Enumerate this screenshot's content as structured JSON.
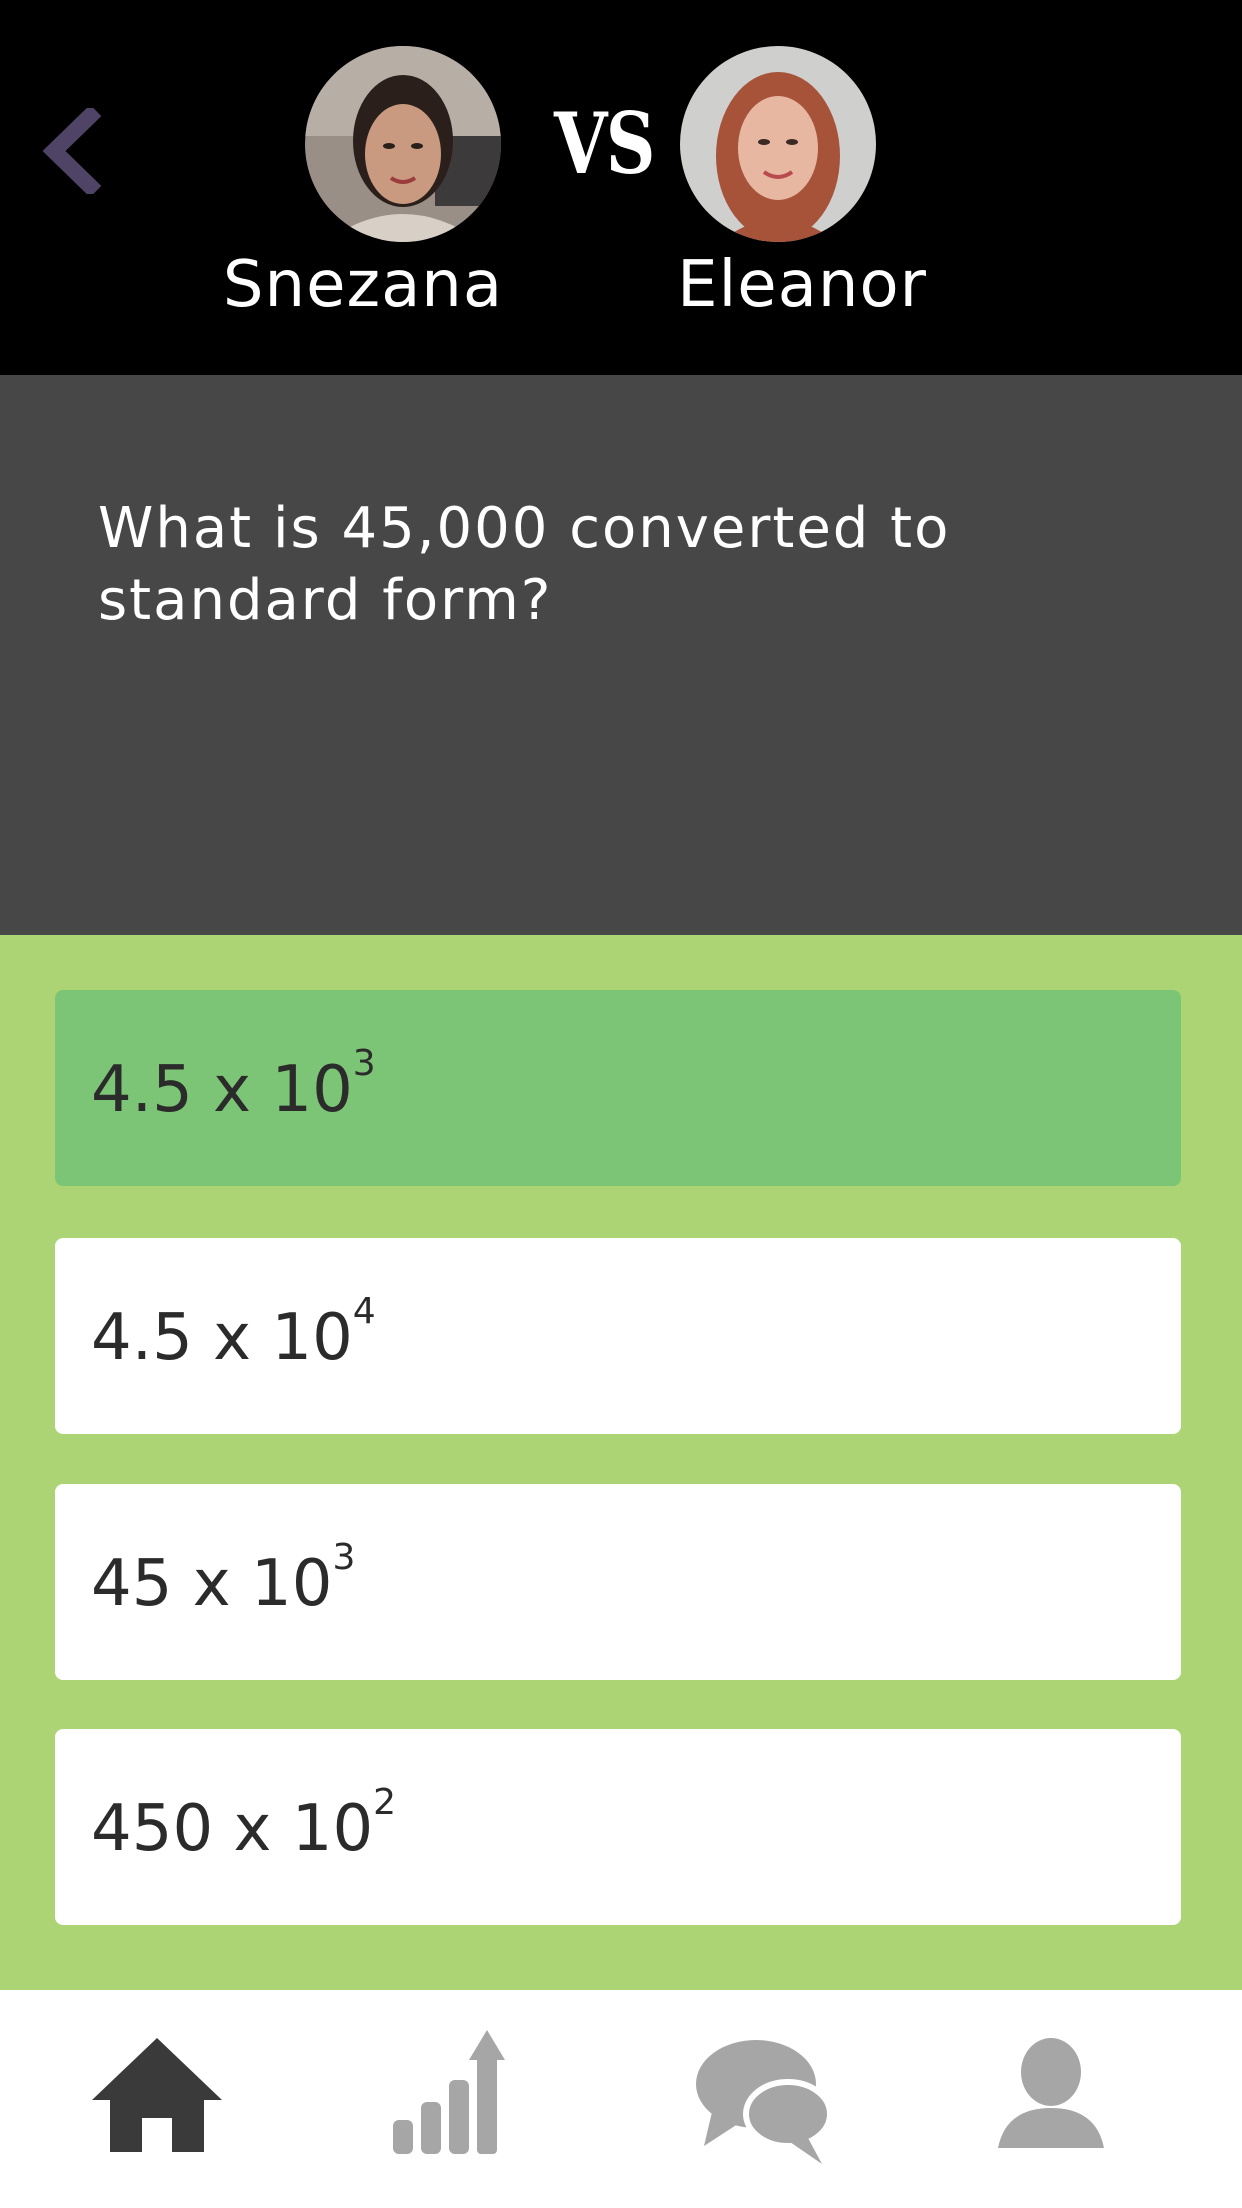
{
  "header": {
    "vs_label": "VS",
    "player1": {
      "name": "Snezana"
    },
    "player2": {
      "name": "Eleanor"
    }
  },
  "question": {
    "text": "What is 45,000 converted to standard form?"
  },
  "answers": [
    {
      "base": "4.5 x 10",
      "exponent": "3",
      "selected": true
    },
    {
      "base": "4.5 x 10",
      "exponent": "4",
      "selected": false
    },
    {
      "base": "45 x 10",
      "exponent": "3",
      "selected": false
    },
    {
      "base": "450 x 10",
      "exponent": "2",
      "selected": false
    }
  ],
  "nav": {
    "items": [
      {
        "icon": "home-icon",
        "active": true
      },
      {
        "icon": "stats-icon",
        "active": false
      },
      {
        "icon": "chat-icon",
        "active": false
      },
      {
        "icon": "profile-icon",
        "active": false
      }
    ]
  },
  "colors": {
    "header_bg": "#000000",
    "question_bg": "#474747",
    "answers_bg": "#acd374",
    "selected_answer": "#7dc576",
    "back_chevron": "#4f4466",
    "nav_active": "#3a3a3a",
    "nav_inactive": "#a6a6a6"
  }
}
